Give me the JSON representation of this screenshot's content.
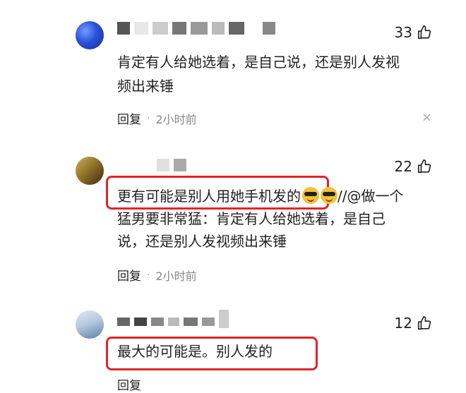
{
  "comments": [
    {
      "likes": "33",
      "text_lines": [
        "肯定有人给她选着，是自己说，还是别人发视",
        "频出来锤"
      ],
      "reply_label": "回复",
      "dot": "·",
      "time": "2小时前",
      "close": "×"
    },
    {
      "likes": "22",
      "highlight_text": "更有可能是别人用她手机发的",
      "after_emoji": "//@做一个",
      "text_lines": [
        "猛男要非常猛：肯定有人给她选着，是自己",
        "说，还是别人发视频出来锤"
      ],
      "reply_label": "回复",
      "dot": "·",
      "time": "2小时前"
    },
    {
      "likes": "12",
      "highlight_text": "最大的可能是。别人发的",
      "reply_label": "回复"
    }
  ],
  "colors": {
    "highlight": "#e0242b",
    "text": "#222222",
    "muted": "#888888"
  },
  "icons": {
    "like": "thumbs-up-icon",
    "close": "close-icon",
    "emoji": "sunglasses-emoji-icon"
  }
}
